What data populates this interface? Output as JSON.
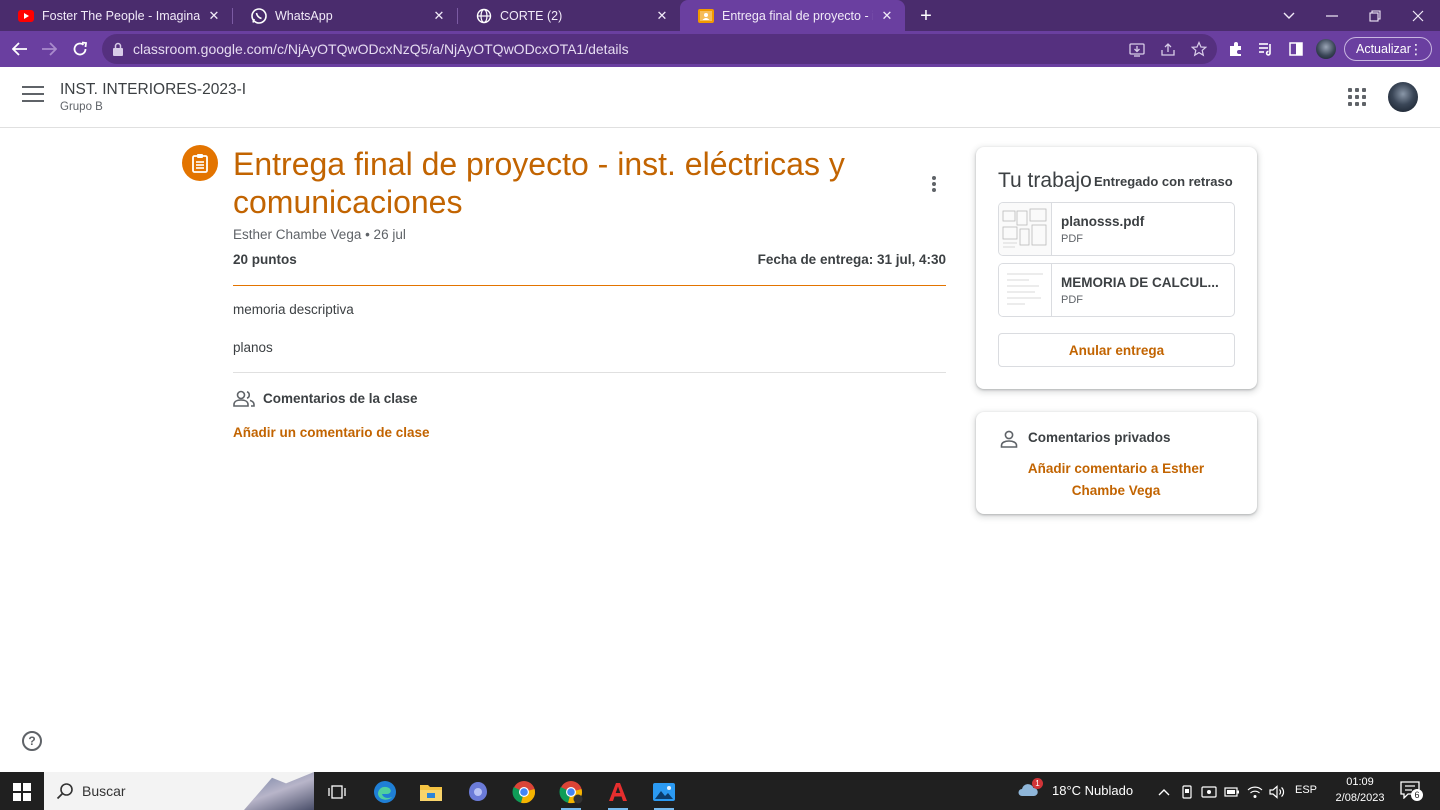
{
  "browser": {
    "tabs": [
      {
        "title": "Foster The People - Imagination (",
        "icon": "youtube-icon",
        "active": false
      },
      {
        "title": "WhatsApp",
        "icon": "whatsapp-icon",
        "active": false
      },
      {
        "title": "CORTE (2)",
        "icon": "globe-icon",
        "active": false
      },
      {
        "title": "Entrega final de proyecto - inst. e",
        "icon": "classroom-icon",
        "active": true
      }
    ],
    "url": "classroom.google.com/c/NjAyOTQwODcxNzQ5/a/NjAyOTQwODcxOTA1/details",
    "update_label": "Actualizar"
  },
  "header": {
    "class_title": "INST. INTERIORES-2023-I",
    "class_subtitle": "Grupo B"
  },
  "assignment": {
    "title": "Entrega final de proyecto - inst. eléctricas y comunicaciones",
    "meta": "Esther Chambe Vega • 26 jul",
    "points": "20 puntos",
    "due": "Fecha de entrega: 31 jul, 4:30",
    "description": [
      "memoria descriptiva",
      "planos"
    ],
    "class_comments_label": "Comentarios de la clase",
    "add_class_comment": "Añadir un comentario de clase"
  },
  "work": {
    "title": "Tu trabajo",
    "status": "Entregado con retraso",
    "attachments": [
      {
        "name": "planosss.pdf",
        "type": "PDF"
      },
      {
        "name": "MEMORIA DE CALCUL...",
        "type": "PDF"
      }
    ],
    "unsubmit_label": "Anular entrega"
  },
  "private_comments": {
    "label": "Comentarios privados",
    "add_label": "Añadir comentario a Esther Chambe Vega"
  },
  "taskbar": {
    "search_placeholder": "Buscar",
    "weather_badge": "1",
    "weather": "18°C  Nublado",
    "language": "ESP",
    "time": "01:09",
    "date": "2/08/2023",
    "notification_count": "6"
  },
  "colors": {
    "accent": "#c26401",
    "tab_strip": "#4a2c6d",
    "toolbar": "#6a3fa0"
  }
}
